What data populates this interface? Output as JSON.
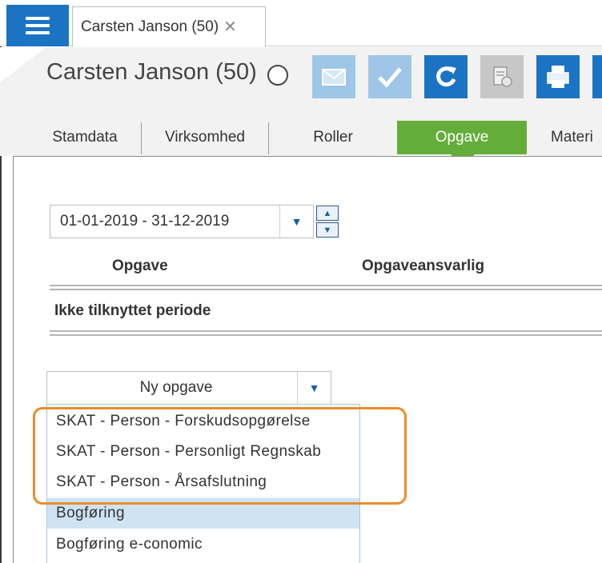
{
  "tab_bar": {
    "menu_icon": "hamburger-menu-icon",
    "document_tab_label": "Carsten Janson (50)",
    "close_icon_glyph": "✕"
  },
  "header": {
    "title": "Carsten Janson (50)",
    "status_icon": "circle-icon",
    "toolbar_icons": [
      "envelope-icon",
      "checkmark-icon",
      "refresh-icon",
      "document-stamp-icon",
      "printer-icon"
    ]
  },
  "nav_tabs": [
    {
      "label": "Stamdata"
    },
    {
      "label": "Virksomhed"
    },
    {
      "label": "Roller"
    },
    {
      "label": "Opgave",
      "selected": true
    },
    {
      "label": "Materi"
    }
  ],
  "period": {
    "value": "01-01-2019 - 31-12-2019"
  },
  "table": {
    "col_task": "Opgave",
    "col_owner": "Opgaveansvarlig",
    "section_unlinked": "Ikke tilknyttet periode"
  },
  "new_task": {
    "label": "Ny opgave",
    "options": [
      "SKAT - Person - Forskudsopgørelse",
      "SKAT - Person - Personligt Regnskab",
      "SKAT - Person - Årsafslutning",
      "Bogføring",
      "Bogføring e-conomic"
    ]
  },
  "colors": {
    "accent_blue": "#1b73c4",
    "selected_tab_green": "#65ad3a",
    "highlight_orange": "#ea8d2a",
    "hover_row": "#cfe3f5"
  }
}
